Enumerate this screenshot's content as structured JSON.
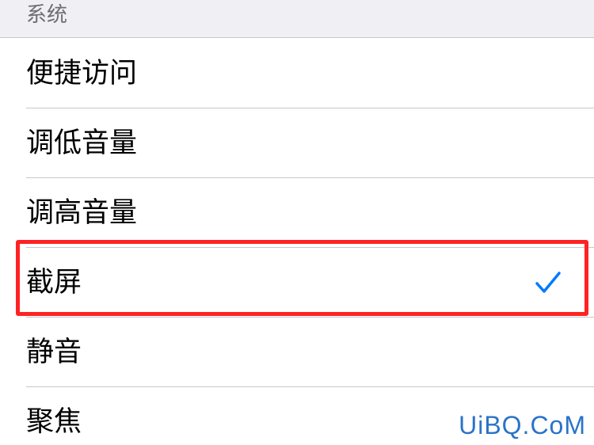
{
  "section": {
    "header": "系统"
  },
  "rows": [
    {
      "label": "便捷访问",
      "selected": false
    },
    {
      "label": "调低音量",
      "selected": false
    },
    {
      "label": "调高音量",
      "selected": false
    },
    {
      "label": "截屏",
      "selected": true
    },
    {
      "label": "静音",
      "selected": false
    },
    {
      "label": "聚焦",
      "selected": false
    }
  ],
  "colors": {
    "checkmark": "#007aff",
    "highlight": "#ff2222",
    "watermark": "#2a73c9"
  },
  "icons": {
    "selected_indicator": "checkmark-icon"
  },
  "watermark": {
    "text": "UiBQ.CoM"
  }
}
